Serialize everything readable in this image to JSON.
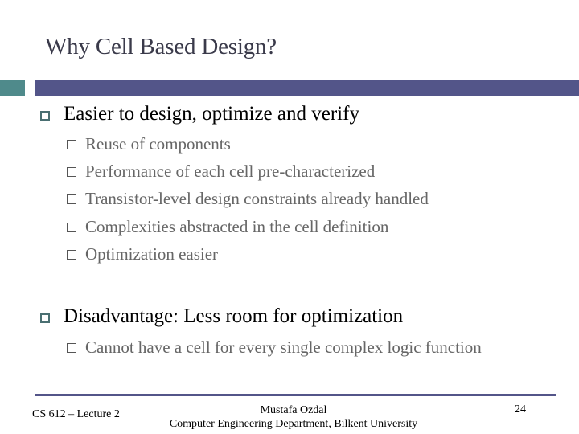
{
  "slide": {
    "title": "Why Cell Based Design?",
    "accent_colors": {
      "left_bar": "#4f8a8b",
      "right_bar": "#535589"
    },
    "bullets": [
      {
        "text": "Easier to design, optimize and verify",
        "sub": [
          "Reuse of components",
          "Performance of each cell pre-characterized",
          "Transistor-level design constraints already handled",
          "Complexities abstracted in the cell definition",
          "Optimization easier"
        ]
      },
      {
        "text": "Disadvantage: Less room for optimization",
        "sub": [
          "Cannot have a cell for every single complex logic function"
        ]
      }
    ]
  },
  "footer": {
    "course": "CS 612 – Lecture 2",
    "author": "Mustafa Ozdal",
    "affiliation": "Computer Engineering Department, Bilkent University",
    "page_number": "24"
  }
}
